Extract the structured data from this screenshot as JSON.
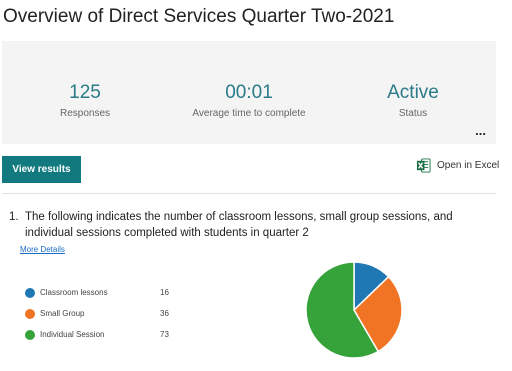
{
  "title": "Overview of Direct Services Quarter Two-2021",
  "stats": [
    {
      "value": "125",
      "label": "Responses"
    },
    {
      "value": "00:01",
      "label": "Average time to complete"
    },
    {
      "value": "Active",
      "label": "Status"
    }
  ],
  "more_menu": "...",
  "actions": {
    "view_results": "View results",
    "open_excel": "Open in Excel"
  },
  "question": {
    "number": "1.",
    "text": "The following indicates the number of classroom lessons, small group sessions, and individual sessions completed with students in quarter 2",
    "more_details": "More Details"
  },
  "colors": {
    "accent": "#127a7f",
    "stat_value": "#2a7a88",
    "link": "#1a6ec4"
  },
  "chart_data": {
    "type": "pie",
    "slices": [
      {
        "label": "Classroom lessons",
        "value": 16,
        "color": "#1f77b4"
      },
      {
        "label": "Small Group",
        "value": 36,
        "color": "#f07423"
      },
      {
        "label": "Individual Session",
        "value": 73,
        "color": "#36a23a"
      }
    ]
  }
}
